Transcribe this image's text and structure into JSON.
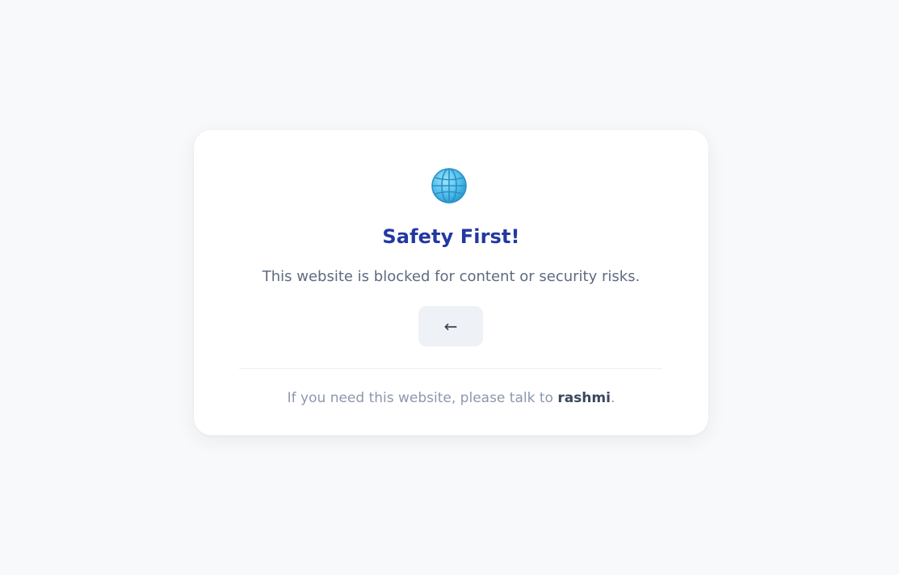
{
  "block_page": {
    "icon": "globe-icon",
    "title": "Safety First!",
    "message": "This website is blocked for content or security risks.",
    "back_button": {
      "label": "←",
      "icon": "arrow-left-icon"
    },
    "footer": {
      "prefix": "If you need this website, please talk to ",
      "contact": "rashmi",
      "suffix": "."
    }
  },
  "colors": {
    "background": "#f8f9fb",
    "card": "#ffffff",
    "title": "#2338a0",
    "message": "#5e6b80",
    "button_bg": "#eef1f6",
    "footer_text": "#8c97ac",
    "footer_contact": "#3b475c"
  }
}
